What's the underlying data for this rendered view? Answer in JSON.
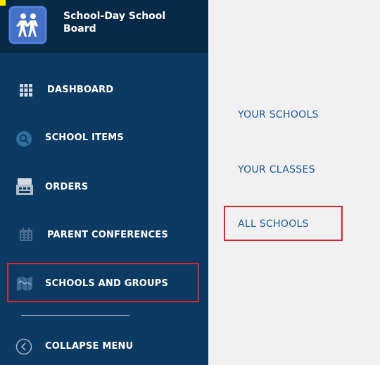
{
  "header": {
    "org_name": "School-Day School\nBoard",
    "logo_icon": "children-walking-icon"
  },
  "sidebar": {
    "items": [
      {
        "label": "DASHBOARD",
        "icon": "grid-icon"
      },
      {
        "label": "SCHOOL ITEMS",
        "icon": "magnifier-icon"
      },
      {
        "label": "ORDERS",
        "icon": "cash-register-icon"
      },
      {
        "label": "PARENT CONFERENCES",
        "icon": "calendar-icon"
      },
      {
        "label": "SCHOOLS AND GROUPS",
        "icon": "map-icon",
        "highlighted": true
      },
      {
        "label": "COLLAPSE MENU",
        "icon": "chevron-left-circle-icon"
      }
    ]
  },
  "submenu": {
    "items": [
      {
        "label": "YOUR SCHOOLS"
      },
      {
        "label": "YOUR CLASSES"
      },
      {
        "label": "ALL SCHOOLS",
        "highlighted": true
      }
    ]
  },
  "colors": {
    "sidebar_bg": "#0d3a62",
    "header_bg": "#082a47",
    "submenu_bg": "#f1f1f1",
    "link": "#1a5a94",
    "highlight": "#e5202c"
  }
}
